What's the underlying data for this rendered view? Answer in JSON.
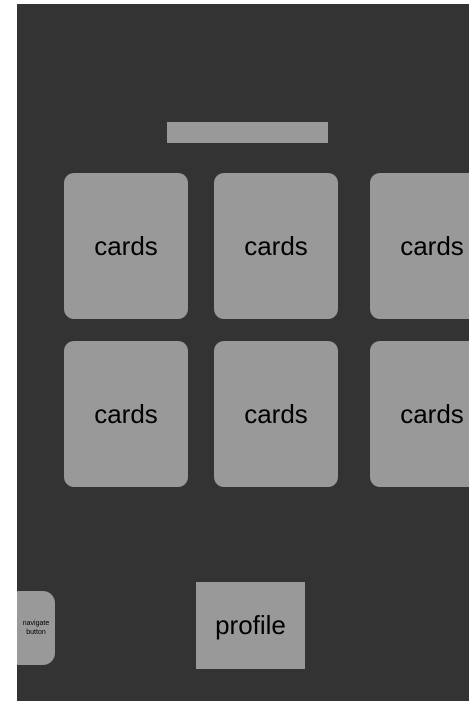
{
  "cards": [
    {
      "label": "cards"
    },
    {
      "label": "cards"
    },
    {
      "label": "cards"
    },
    {
      "label": "cards"
    },
    {
      "label": "cards"
    },
    {
      "label": "cards"
    }
  ],
  "nav_button": {
    "label": "navigate button"
  },
  "profile_button": {
    "label": "profile"
  },
  "colors": {
    "background": "#333333",
    "element": "#999999",
    "text": "#000000"
  }
}
